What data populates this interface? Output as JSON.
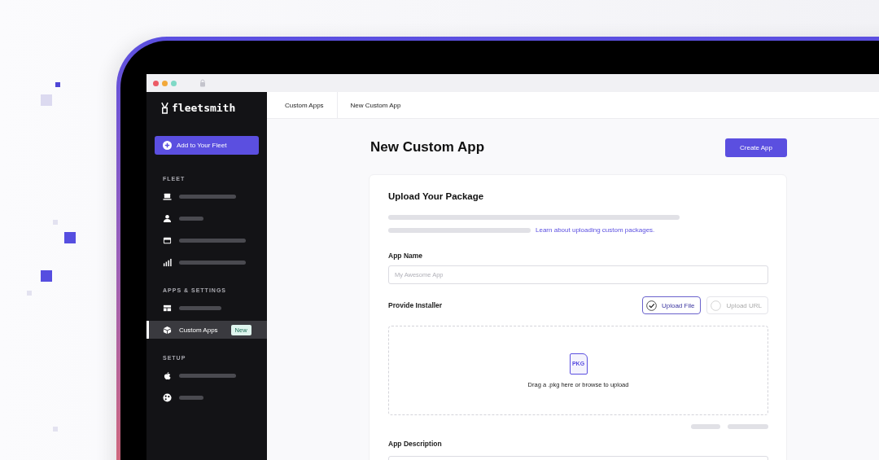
{
  "logo": {
    "text": "fleetsmith"
  },
  "add_button": {
    "label": "Add to Your Fleet"
  },
  "sidebar": [
    {
      "heading": "FLEET",
      "items": [
        {
          "selected": false
        },
        {
          "selected": false
        },
        {
          "selected": false
        },
        {
          "selected": false
        }
      ]
    },
    {
      "heading": "APPS & SETTINGS",
      "items": [
        {
          "selected": false
        },
        {
          "label": "Custom Apps",
          "badge": "New",
          "selected": true
        }
      ]
    },
    {
      "heading": "SETUP",
      "items": [
        {
          "selected": false
        },
        {
          "selected": false
        }
      ]
    }
  ],
  "breadcrumbs": [
    "Custom Apps",
    "New Custom App"
  ],
  "page_title": "New Custom App",
  "create_button": {
    "label": "Create App"
  },
  "card": {
    "title": "Upload Your Package",
    "link": "Learn about uploading custom packages.",
    "app_name": {
      "label": "App Name",
      "placeholder": "My Awesome App"
    },
    "installer": {
      "label": "Provide Installer",
      "options": [
        {
          "label": "Upload File",
          "selected": true
        },
        {
          "label": "Upload URL",
          "selected": false
        }
      ]
    },
    "dropzone": {
      "icon_text": "PKG",
      "text": "Drag a .pkg here or browse to upload"
    },
    "description": {
      "label": "App Description"
    }
  }
}
